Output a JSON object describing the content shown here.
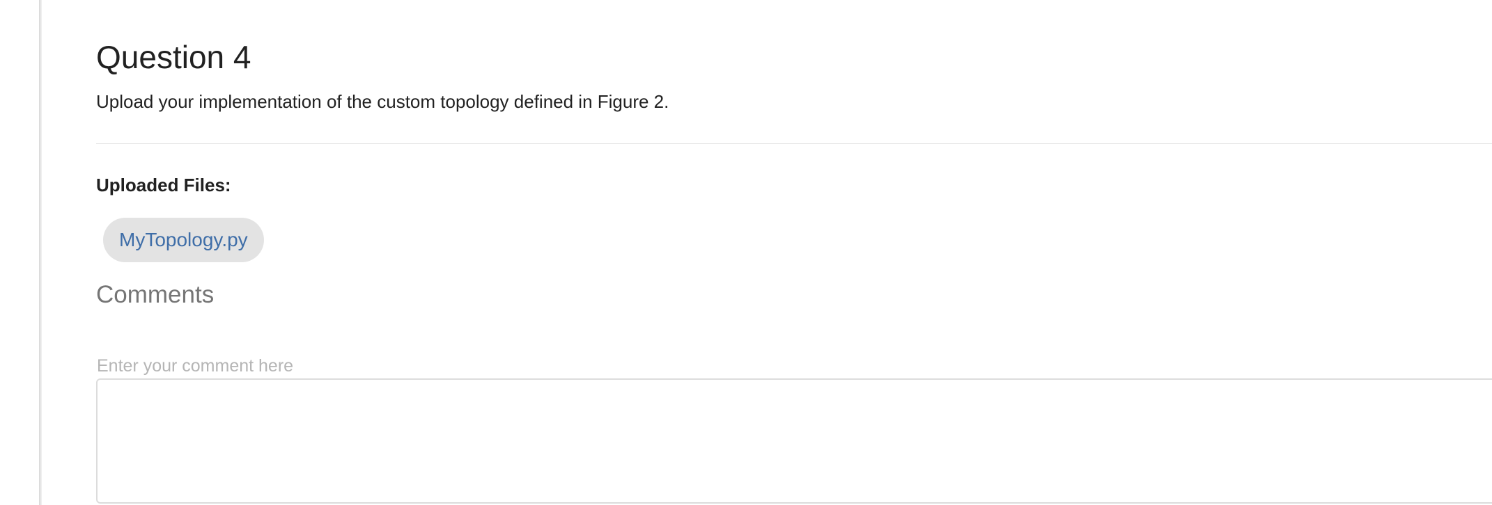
{
  "question": {
    "title": "Question 4",
    "prompt": "Upload your implementation of the custom topology defined in Figure 2."
  },
  "uploads": {
    "label": "Uploaded Files:",
    "files": [
      {
        "name": "MyTopology.py"
      }
    ]
  },
  "comments": {
    "heading": "Comments",
    "placeholder": "Enter your comment here",
    "value": ""
  }
}
